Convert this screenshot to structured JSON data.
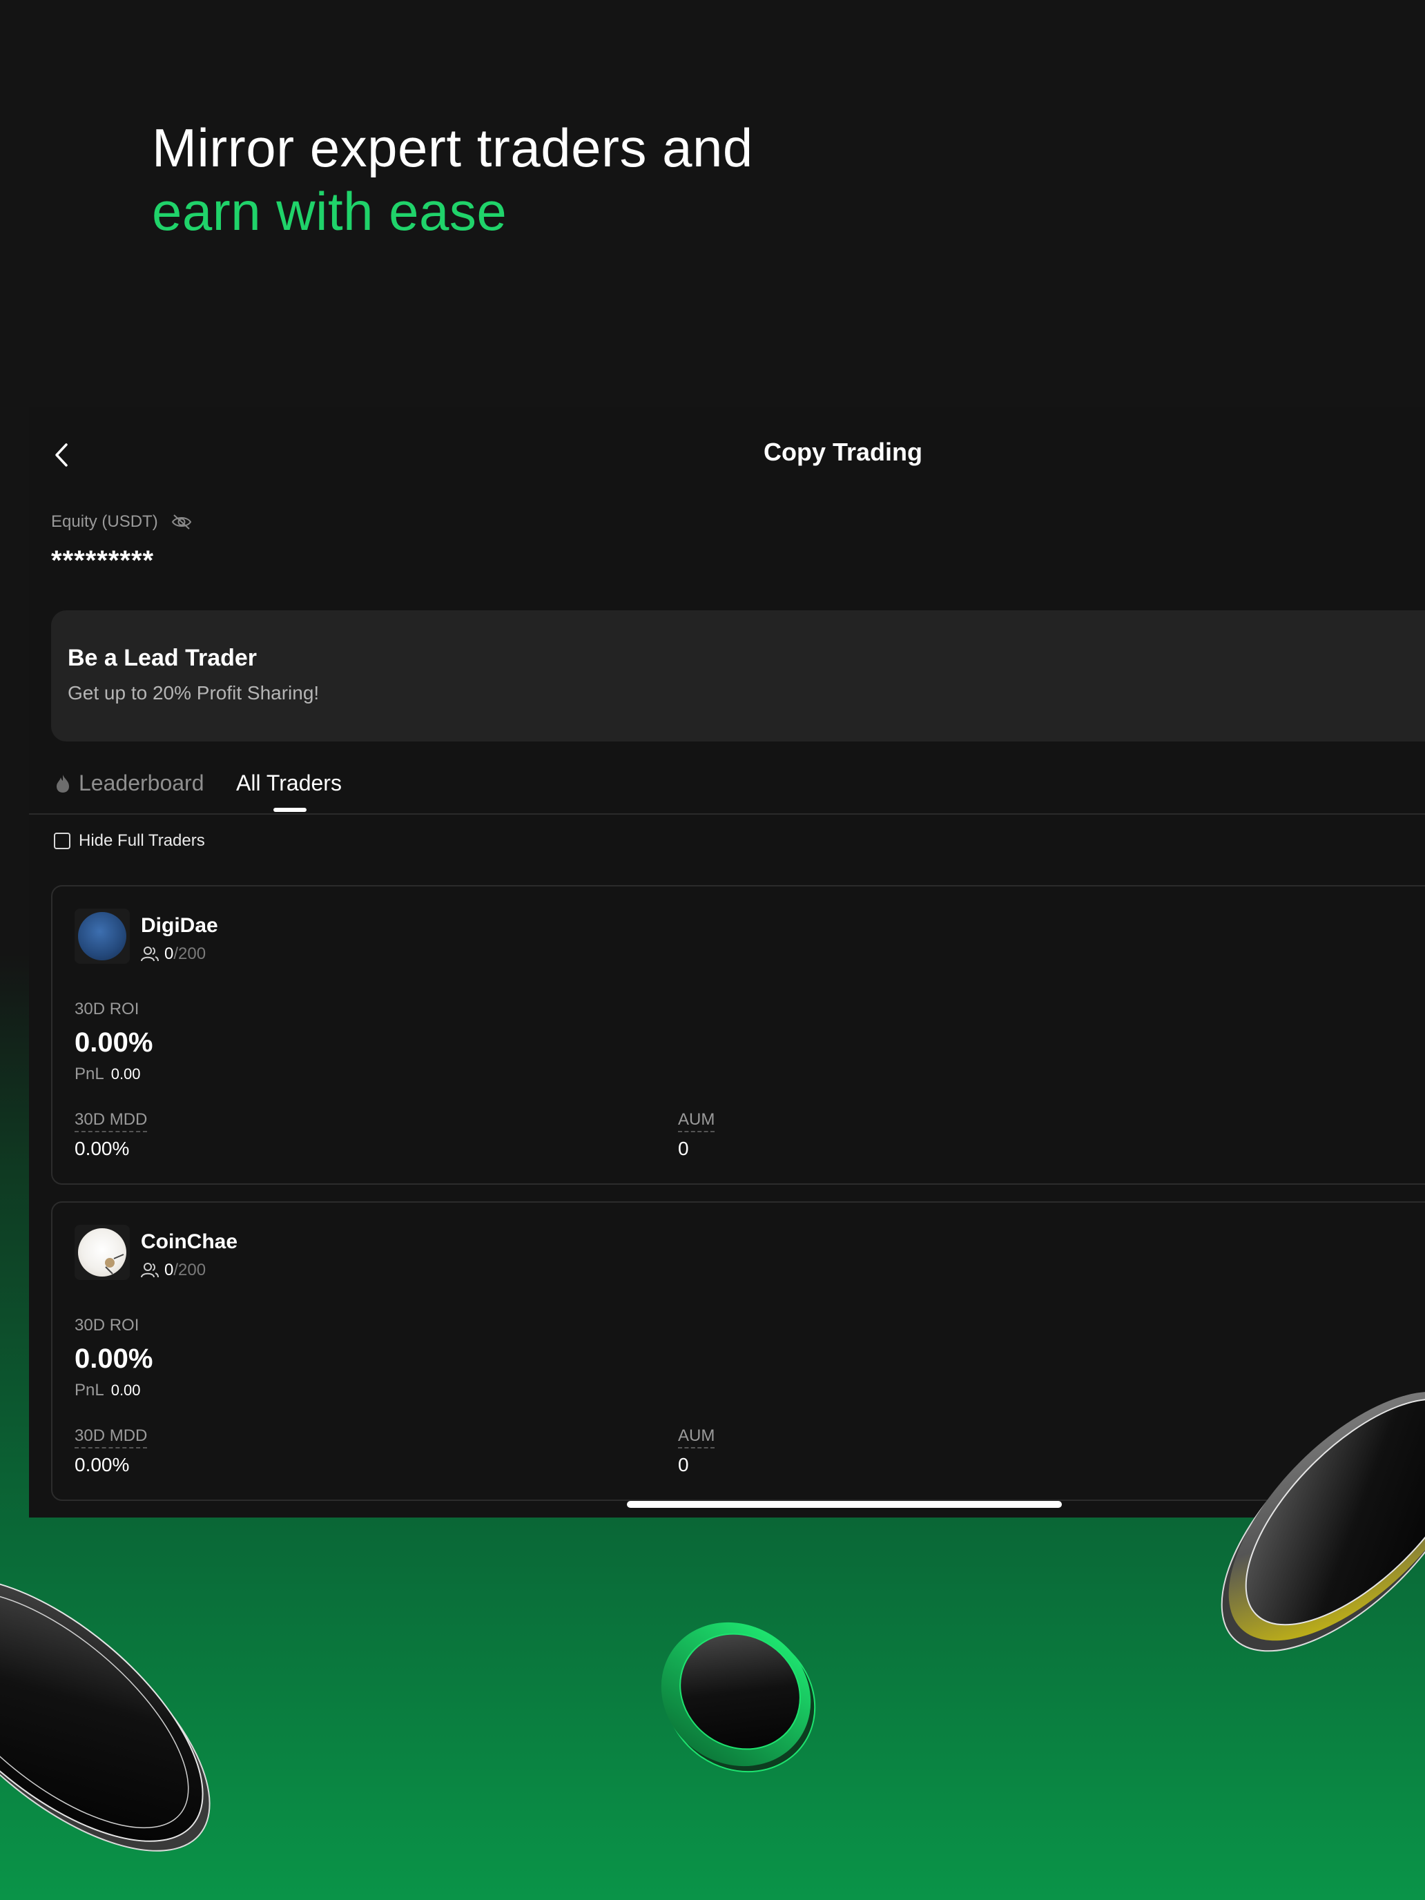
{
  "hero": {
    "line1": "Mirror expert traders and",
    "line2": "earn with ease"
  },
  "navbar": {
    "title": "Copy Trading"
  },
  "equity": {
    "label": "Equity (USDT)",
    "value": "*********"
  },
  "lead_banner": {
    "title": "Be a Lead Trader",
    "subtitle": "Get up to 20% Profit Sharing!"
  },
  "tabs": [
    {
      "label": "Leaderboard",
      "active": false
    },
    {
      "label": "All Traders",
      "active": true
    }
  ],
  "filter": {
    "hide_full_label": "Hide Full Traders"
  },
  "traders": [
    {
      "name": "DigiDae",
      "followers": "0",
      "capacity": "/200",
      "roi_label": "30D ROI",
      "roi_value": "0.00%",
      "pnl_label": "PnL",
      "pnl_value": "0.00",
      "mdd_label": "30D MDD",
      "mdd_value": "0.00%",
      "aum_label": "AUM",
      "aum_value": "0"
    },
    {
      "name": "CoinChae",
      "followers": "0",
      "capacity": "/200",
      "roi_label": "30D ROI",
      "roi_value": "0.00%",
      "pnl_label": "PnL",
      "pnl_value": "0.00",
      "mdd_label": "30D MDD",
      "mdd_value": "0.00%",
      "aum_label": "AUM",
      "aum_value": "0"
    }
  ],
  "colors": {
    "accent_green": "#20d36a",
    "background": "#141414",
    "card_bg": "#131313",
    "banner_bg": "#232323"
  },
  "icons": [
    "back-chevron-icon",
    "eye-hidden-icon",
    "flame-icon",
    "users-icon"
  ]
}
